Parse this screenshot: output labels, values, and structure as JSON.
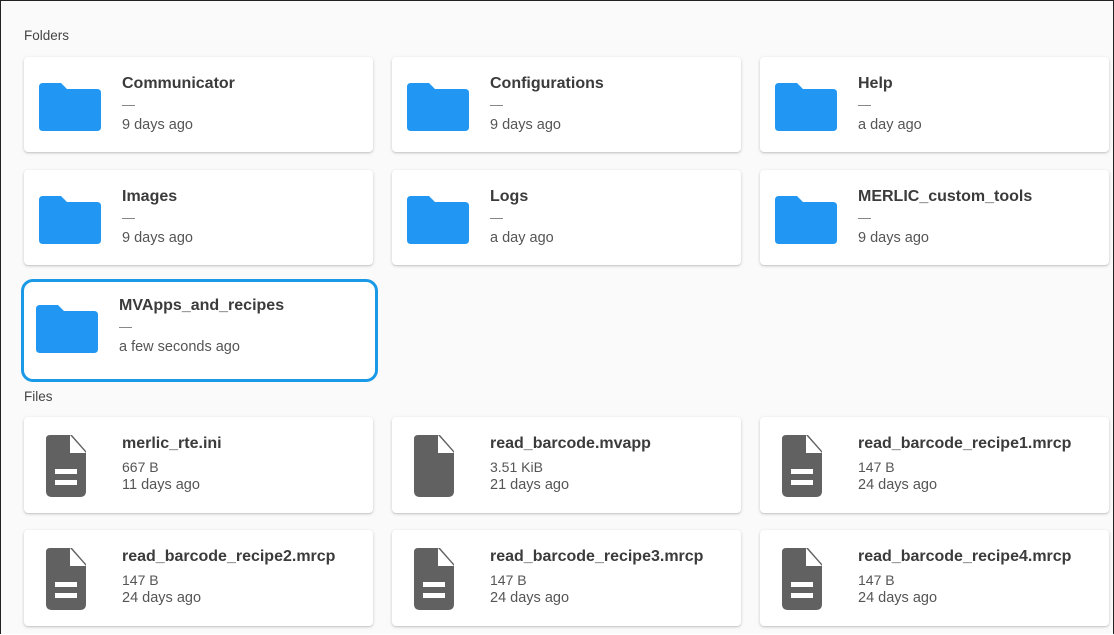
{
  "sections": {
    "folders_label": "Folders",
    "files_label": "Files"
  },
  "folders": [
    {
      "name": "Communicator",
      "dash": "—",
      "modified": "9 days ago"
    },
    {
      "name": "Configurations",
      "dash": "—",
      "modified": "9 days ago"
    },
    {
      "name": "Help",
      "dash": "—",
      "modified": "a day ago"
    },
    {
      "name": "Images",
      "dash": "—",
      "modified": "9 days ago"
    },
    {
      "name": "Logs",
      "dash": "—",
      "modified": "a day ago"
    },
    {
      "name": "MERLIC_custom_tools",
      "dash": "—",
      "modified": "9 days ago"
    },
    {
      "name": "MVApps_and_recipes",
      "dash": "—",
      "modified": "a few seconds ago",
      "selected": true
    }
  ],
  "files": [
    {
      "name": "merlic_rte.ini",
      "size": "667 B",
      "modified": "11 days ago",
      "icon": "text-file-icon"
    },
    {
      "name": "read_barcode.mvapp",
      "size": "3.51 KiB",
      "modified": "21 days ago",
      "icon": "blank-file-icon"
    },
    {
      "name": "read_barcode_recipe1.mrcp",
      "size": "147 B",
      "modified": "24 days ago",
      "icon": "text-file-icon"
    },
    {
      "name": "read_barcode_recipe2.mrcp",
      "size": "147 B",
      "modified": "24 days ago",
      "icon": "text-file-icon"
    },
    {
      "name": "read_barcode_recipe3.mrcp",
      "size": "147 B",
      "modified": "24 days ago",
      "icon": "text-file-icon"
    },
    {
      "name": "read_barcode_recipe4.mrcp",
      "size": "147 B",
      "modified": "24 days ago",
      "icon": "text-file-icon"
    }
  ],
  "colors": {
    "folder": "#2196f3",
    "file": "#616161",
    "selection": "#1a9ae6"
  }
}
